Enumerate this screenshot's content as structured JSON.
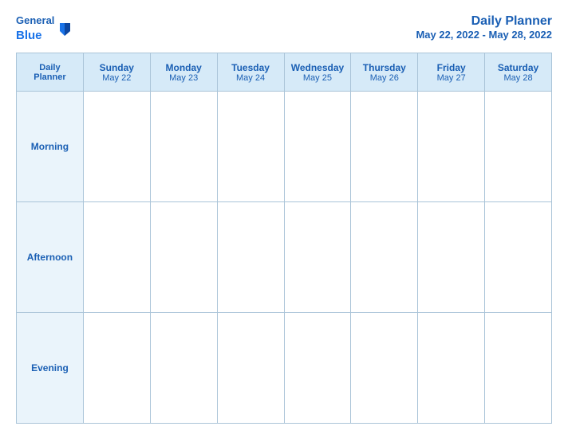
{
  "header": {
    "logo_general": "General",
    "logo_blue": "Blue",
    "main_title": "Daily Planner",
    "date_range": "May 22, 2022 - May 28, 2022"
  },
  "columns": [
    {
      "id": "label-col",
      "day": "Daily",
      "day2": "Planner",
      "date": ""
    },
    {
      "id": "sunday",
      "day": "Sunday",
      "date": "May 22"
    },
    {
      "id": "monday",
      "day": "Monday",
      "date": "May 23"
    },
    {
      "id": "tuesday",
      "day": "Tuesday",
      "date": "May 24"
    },
    {
      "id": "wednesday",
      "day": "Wednesday",
      "date": "May 25"
    },
    {
      "id": "thursday",
      "day": "Thursday",
      "date": "May 26"
    },
    {
      "id": "friday",
      "day": "Friday",
      "date": "May 27"
    },
    {
      "id": "saturday",
      "day": "Saturday",
      "date": "May 28"
    }
  ],
  "rows": [
    {
      "id": "morning",
      "label": "Morning"
    },
    {
      "id": "afternoon",
      "label": "Afternoon"
    },
    {
      "id": "evening",
      "label": "Evening"
    }
  ]
}
